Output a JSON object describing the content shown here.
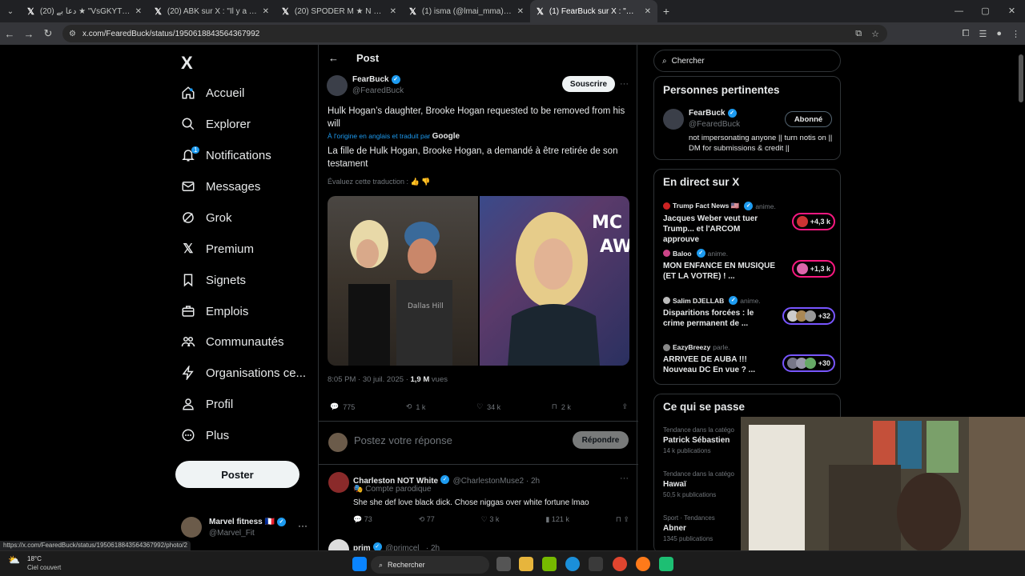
{
  "browser": {
    "tabs": [
      {
        "title": "(20) دعا بے ★ \"VsGKYTgmxmL"
      },
      {
        "title": "(20) ABK sur X : \"Il y a un mec"
      },
      {
        "title": "(20) SPODER M ★ N sur X : \"C'e"
      },
      {
        "title": "(1) isma (@lmai_mma) / X"
      },
      {
        "title": "(1) FearBuck sur X : \"Hulk Hoga"
      }
    ],
    "url": "x.com/FearedBuck/status/1950618843564367992",
    "status_url": "https://x.com/FearedBuck/status/1950618843564367992/photo/2"
  },
  "sidebar": {
    "logo": "X",
    "items": [
      {
        "label": "Accueil",
        "icon": "home-icon"
      },
      {
        "label": "Explorer",
        "icon": "search-icon"
      },
      {
        "label": "Notifications",
        "icon": "bell-icon",
        "badge": "1"
      },
      {
        "label": "Messages",
        "icon": "mail-icon"
      },
      {
        "label": "Grok",
        "icon": "grok-icon"
      },
      {
        "label": "Premium",
        "icon": "x-icon"
      },
      {
        "label": "Signets",
        "icon": "bookmark-icon"
      },
      {
        "label": "Emplois",
        "icon": "briefcase-icon"
      },
      {
        "label": "Communautés",
        "icon": "people-icon"
      },
      {
        "label": "Organisations ce...",
        "icon": "bolt-icon"
      },
      {
        "label": "Profil",
        "icon": "person-icon"
      },
      {
        "label": "Plus",
        "icon": "more-icon"
      }
    ],
    "post_button": "Poster",
    "account": {
      "name": "Marvel fitness 🇫🇷",
      "handle": "@Marvel_Fit"
    }
  },
  "post": {
    "header": "Post",
    "author": "FearBuck",
    "handle": "@FearedBuck",
    "subscribe": "Souscrire",
    "text": "Hulk Hogan’s daughter, Brooke Hogan requested to be removed from his will",
    "translated_note": "À l'origine en anglais et traduit par",
    "translator": "Google",
    "translation": "La fille de Hulk Hogan, Brooke Hogan, a demandé à être retirée de son testament",
    "evaluate": "Évaluez cette traduction :",
    "time": "8:05 PM · 30 juil. 2025 · ",
    "views": "1,9 M",
    "views_label": " vues",
    "replies": "775",
    "reposts": "1 k",
    "likes": "34 k",
    "bookmarks": "2 k",
    "reply_placeholder": "Postez votre réponse",
    "reply_button": "Répondre"
  },
  "replies": [
    {
      "name": "Charleston NOT White",
      "handle": "@CharlestonMuse2 · 2h",
      "tag": "Compte parodique",
      "text": "She she def love black dick. Chose niggas over white fortune lmao",
      "replies": "73",
      "reposts": "77",
      "likes": "3 k",
      "views": "121 k"
    },
    {
      "name": "prim",
      "handle": "@primcel_ · 2h"
    }
  ],
  "right": {
    "search_placeholder": "Chercher",
    "relevant": {
      "title": "Personnes pertinentes",
      "name": "FearBuck",
      "handle": "@FearedBuck",
      "follow": "Abonné",
      "bio": "not impersonating anyone || turn notis on || DM for submissions & credit ||"
    },
    "live": {
      "title": "En direct sur X",
      "items": [
        {
          "host": "Trump Fact News 🇺🇸",
          "verb": "anime.",
          "title": "Jacques Weber veut tuer Trump... et l'ARCOM approuve",
          "count": "+4,3 k"
        },
        {
          "host": "Baloo",
          "verb": "anime.",
          "title": "MON ENFANCE EN MUSIQUE (ET LA VOTRE) ! ...",
          "count": "+1,3 k"
        },
        {
          "host": "Salim DJELLAB",
          "verb": "anime.",
          "title": "Disparitions forcées : le crime permanent de ...",
          "count": "+32"
        },
        {
          "host": "EazyBreezy",
          "verb": "parle.",
          "title": "ARRIVEE DE AUBA !!! Nouveau DC En vue ? ...",
          "count": "+30"
        }
      ]
    },
    "trends": {
      "title": "Ce qui se passe",
      "items": [
        {
          "cat": "Tendance dans la catégo",
          "name": "Patrick Sébastien",
          "count": "14 k publications"
        },
        {
          "cat": "Tendance dans la catégo",
          "name": "Hawaï",
          "count": "50,5 k publications"
        },
        {
          "cat": "Sport · Tendances",
          "name": "Abner",
          "count": "1345 publications"
        }
      ]
    }
  },
  "taskbar": {
    "weather_temp": "18°C",
    "weather_desc": "Ciel couvert",
    "search": "Rechercher"
  }
}
